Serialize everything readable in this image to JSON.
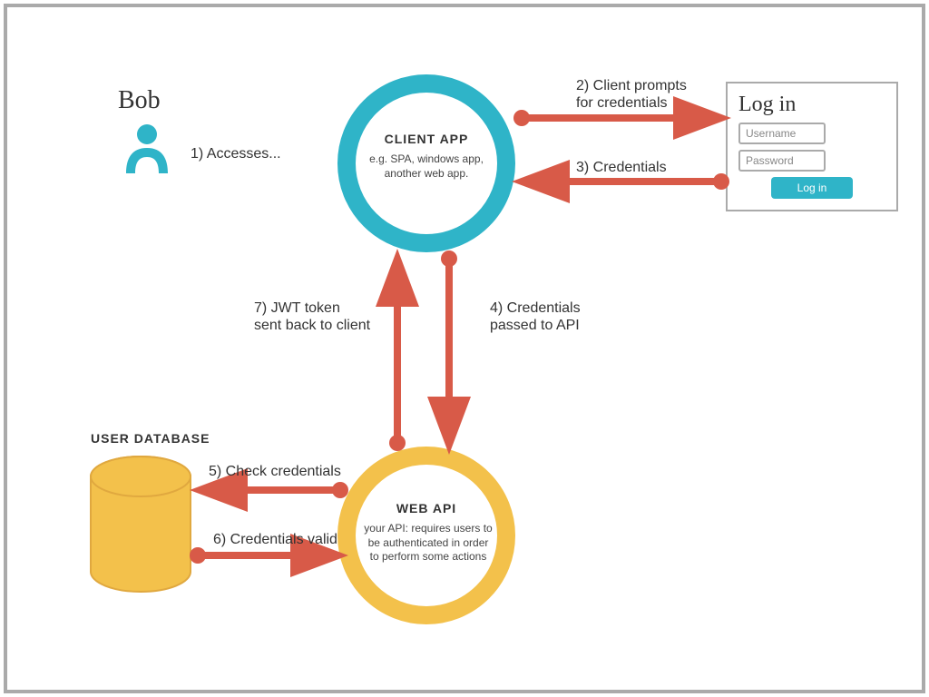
{
  "actor": {
    "name": "Bob"
  },
  "steps": {
    "s1": "1) Accesses...",
    "s2": "2) Client prompts\nfor credentials",
    "s3": "3) Credentials",
    "s4": "4) Credentials\npassed to API",
    "s5": "5) Check credentials",
    "s6": "6) Credentials valid",
    "s7": "7) JWT token\nsent back to client"
  },
  "client": {
    "title": "CLIENT APP",
    "sub": "e.g. SPA, windows app,\nanother web app."
  },
  "api": {
    "title": "WEB API",
    "sub": "your API: requires users to\nbe authenticated in order\nto perform some actions"
  },
  "db": {
    "title": "USER DATABASE"
  },
  "login": {
    "title": "Log in",
    "username_ph": "Username",
    "password_ph": "Password",
    "button": "Log in"
  },
  "colors": {
    "red": "#d85a48",
    "teal": "#2fb4c8",
    "yellow": "#f3c14b",
    "yellow_stroke": "#e0a83f",
    "gray": "#aaaaaa"
  }
}
